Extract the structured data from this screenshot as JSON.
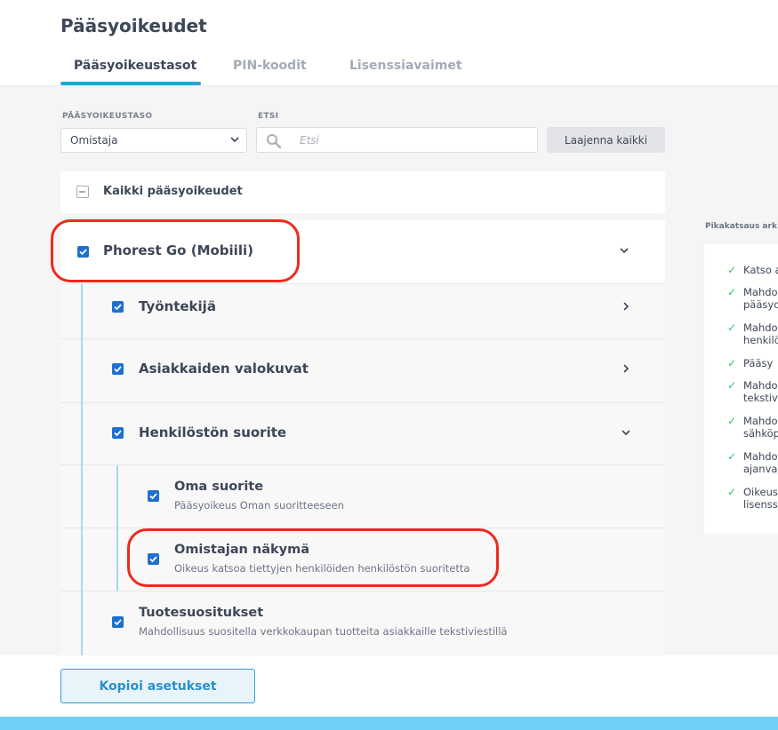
{
  "header": {
    "title": "Pääsyoikeudet",
    "tabs": [
      {
        "label": "Pääsyoikeustasot",
        "active": true
      },
      {
        "label": "PIN-koodit",
        "active": false
      },
      {
        "label": "Lisenssiavaimet",
        "active": false
      }
    ]
  },
  "filters": {
    "level_label": "PÄÄSYOIKEUSTASO",
    "level_value": "Omistaja",
    "search_label": "ETSI",
    "search_placeholder": "Etsi",
    "expand_all": "Laajenna kaikki"
  },
  "all_permissions": "Kaikki pääsyoikeudet",
  "tree": {
    "root": {
      "title": "Phorest Go (Mobiili)",
      "checked": true,
      "expanded": true
    },
    "items": [
      {
        "title": "Työntekijä",
        "checked": true,
        "expanded": false
      },
      {
        "title": "Asiakkaiden valokuvat",
        "checked": true,
        "expanded": false
      },
      {
        "title": "Henkilöstön suorite",
        "checked": true,
        "expanded": true,
        "children": [
          {
            "title": "Oma suorite",
            "subtitle": "Pääsyoikeus Oman suoritteeseen",
            "checked": true
          },
          {
            "title": "Omistajan näkymä",
            "subtitle": "Oikeus katsoa tiettyjen henkilöiden henkilöstön suoritetta",
            "checked": true
          }
        ]
      },
      {
        "title": "Tuotesuositukset",
        "subtitle": "Mahdollisuus suositella verkkokaupan tuotteita asiakkaille tekstiviestillä",
        "checked": true
      }
    ]
  },
  "sidebar": {
    "title": "Pikakatsaus ark",
    "items": [
      [
        "Katso a"
      ],
      [
        "Mahdo",
        "pääsyo"
      ],
      [
        "Mahdo",
        "henkilö"
      ],
      [
        "Pääsy"
      ],
      [
        "Mahdo",
        "tekstiv"
      ],
      [
        "Mahdo",
        "sähköp"
      ],
      [
        "Mahdo",
        "ajanva"
      ],
      [
        "Oikeus",
        "lisenss"
      ]
    ]
  },
  "footer": {
    "copy_button": "Kopioi asetukset"
  },
  "colors": {
    "accent": "#2a9fd6",
    "checkbox": "#1f6fd1",
    "highlight": "#ee2a1b",
    "check_green": "#34c06c"
  }
}
